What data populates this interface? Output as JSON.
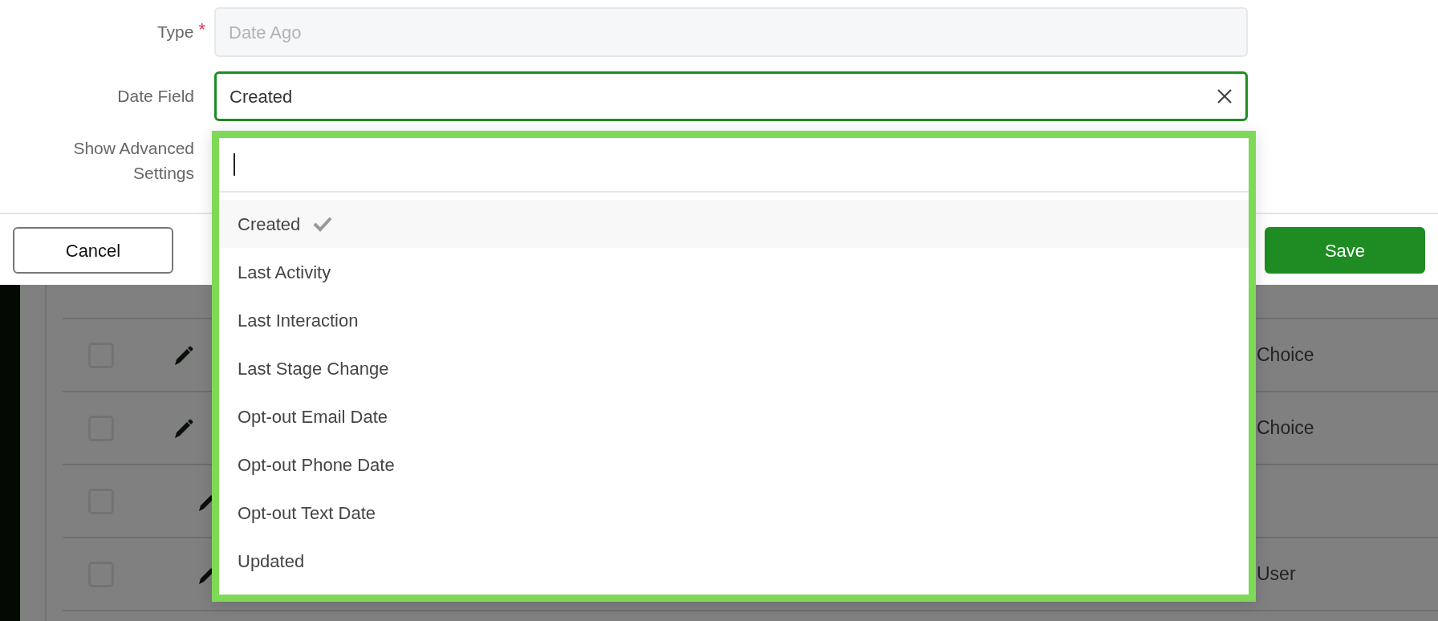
{
  "form": {
    "fields": [
      {
        "kind": "text",
        "label": "Type",
        "required_mark": "*",
        "value": "Date Ago",
        "disabled": true,
        "focused": false
      },
      {
        "kind": "select",
        "label": "Date Field",
        "value": "Created",
        "disabled": false,
        "focused": true
      },
      {
        "kind": "toggle_label",
        "label": "Show Advanced Settings"
      }
    ],
    "buttons": [
      {
        "label": "Cancel",
        "kind": "secondary"
      },
      {
        "label": "Save",
        "kind": "primary"
      }
    ]
  },
  "dropdown": {
    "options": [
      {
        "label": "Created",
        "selected": true
      },
      {
        "label": "Last Activity",
        "selected": false
      },
      {
        "label": "Last Interaction",
        "selected": false
      },
      {
        "label": "Last Stage Change",
        "selected": false
      },
      {
        "label": "Opt-out Email Date",
        "selected": false
      },
      {
        "label": "Opt-out Phone Date",
        "selected": false
      },
      {
        "label": "Opt-out Text Date",
        "selected": false
      },
      {
        "label": "Updated",
        "selected": false
      }
    ]
  },
  "table": {
    "rows": [
      {
        "checked": false,
        "column_3": "Choice"
      },
      {
        "checked": false,
        "column_3": "Choice",
        "children": [
          {
            "checked": false
          },
          {
            "checked": false,
            "column_3": "User"
          }
        ]
      }
    ]
  }
}
